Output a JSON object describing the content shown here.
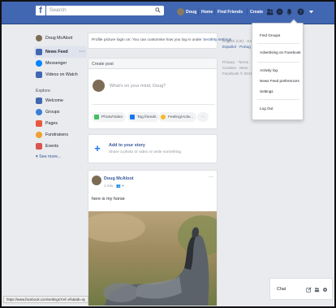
{
  "topbar": {
    "search_placeholder": "Search",
    "profile_name": "Doug",
    "home_label": "Home",
    "find_friends_label": "Find Friends",
    "create_label": "Create",
    "brand_color": "#4267b2"
  },
  "sidebar": {
    "user_name": "Doug McAloot",
    "items": [
      {
        "label": "News Feed",
        "icon": "news-feed-icon",
        "color": "#4267b2"
      },
      {
        "label": "Messenger",
        "icon": "messenger-icon",
        "color": "#0084ff"
      },
      {
        "label": "Videos on Watch",
        "icon": "watch-icon",
        "color": "#4267b2"
      }
    ],
    "explore_heading": "Explore",
    "explore_items": [
      {
        "label": "Welcome",
        "icon": "welcome-icon",
        "color": "#4267b2"
      },
      {
        "label": "Groups",
        "icon": "groups-icon",
        "color": "#3b7dd8"
      },
      {
        "label": "Pages",
        "icon": "pages-icon",
        "color": "#e9573f"
      },
      {
        "label": "Fundraisers",
        "icon": "fundraisers-icon",
        "color": "#f0a030"
      },
      {
        "label": "Events",
        "icon": "events-icon",
        "color": "#d9534f"
      }
    ],
    "see_more": "▾ See more..."
  },
  "notice": {
    "text": "Profile picture login on: You can customise how you log in under",
    "link": "Security settings."
  },
  "create_post": {
    "header": "Create post",
    "prompt": "What's on your mind, Doug?",
    "buttons": [
      "Photo/Video",
      "Tag friends",
      "Feeling/Activ..."
    ],
    "more": "···"
  },
  "story": {
    "title": "Add to your story",
    "subtitle": "Share a photo or video or write something"
  },
  "post": {
    "author": "Doug McAloot",
    "meta": "1 min · 👥 ▾",
    "text": "here is my horse"
  },
  "right_column": {
    "lang_current": "English (UK) · En",
    "lang_links": "Español · Portug",
    "footer_1": "Privacy · Terms ·",
    "footer_2": "Cookies · More ·",
    "footer_3": "Facebook © 2019"
  },
  "menu": {
    "items": [
      "Find Groups",
      "Advertising on Facebook",
      "Activity log",
      "News Feed preferences",
      "Settings",
      "Log Out"
    ]
  },
  "chat": {
    "label": "Chat"
  },
  "status_bar": {
    "url": "https://www.facebook.com/settings?ref=nfs&tab=sy"
  }
}
